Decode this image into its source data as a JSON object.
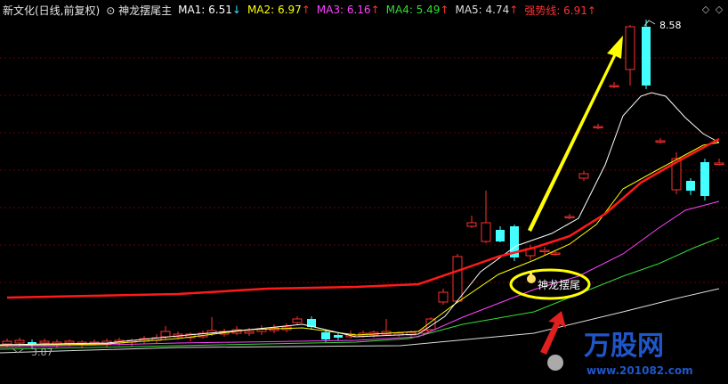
{
  "header": {
    "title": "新文化(日线,前复权)",
    "indicator_marker": "⊙",
    "indicator_name": "神龙摆尾主",
    "ma1": {
      "label": "MA1: 6.51",
      "arrow": "↓"
    },
    "ma2": {
      "label": "MA2: 6.97",
      "arrow": "↑"
    },
    "ma3": {
      "label": "MA3: 6.16",
      "arrow": "↑"
    },
    "ma4": {
      "label": "MA4: 5.49",
      "arrow": "↑"
    },
    "ma5": {
      "label": "MA5: 4.74",
      "arrow": "↑"
    },
    "strong": {
      "label": "强势线: 6.91",
      "arrow": "↑"
    },
    "btn_down": "◇",
    "btn_up": "◇"
  },
  "chart": {
    "price_high_label": "8.58",
    "price_low_label": "3.87",
    "annotation_text": "神龙摆尾",
    "watermark_text": "万股网",
    "watermark_url": "www.201082.com",
    "colors": {
      "up": "#ff3030",
      "down": "#44ffff",
      "ma1": "#ffffff",
      "ma2": "#ffff00",
      "ma3": "#ff44ff",
      "ma4": "#33dd33",
      "ma5": "#dddddd",
      "strong": "#ff1a1a",
      "annotation": "#ffff00"
    }
  }
}
